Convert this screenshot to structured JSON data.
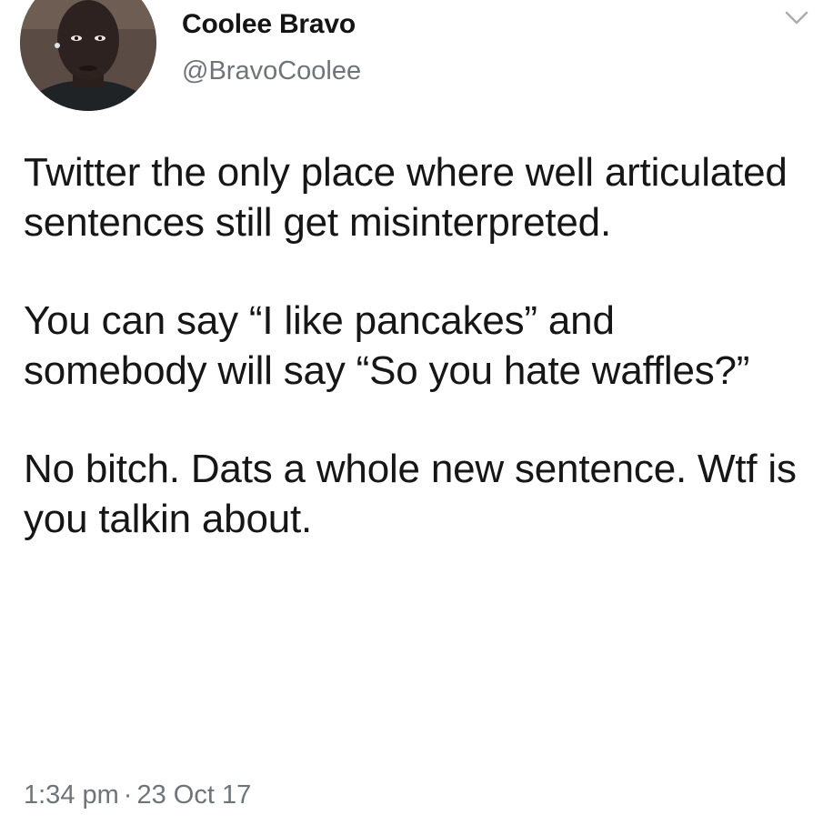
{
  "author": {
    "name": "Coolee Bravo",
    "handle": "@BravoCoolee",
    "avatar_icon": "profile-avatar"
  },
  "menu": {
    "icon": "chevron-down-icon"
  },
  "tweet": {
    "paragraphs": [
      "Twitter the only place where well articulated sentences still get misinterpreted.",
      "You can say “I like pancakes” and somebody will say “So you hate waffles?”",
      "No bitch. Dats a whole new sentence. Wtf is you talkin about."
    ]
  },
  "meta": {
    "time": "1:34 pm",
    "separator": "·",
    "date": "23 Oct 17"
  },
  "colors": {
    "text": "#161616",
    "secondary": "#6f7479",
    "background": "#ffffff"
  }
}
